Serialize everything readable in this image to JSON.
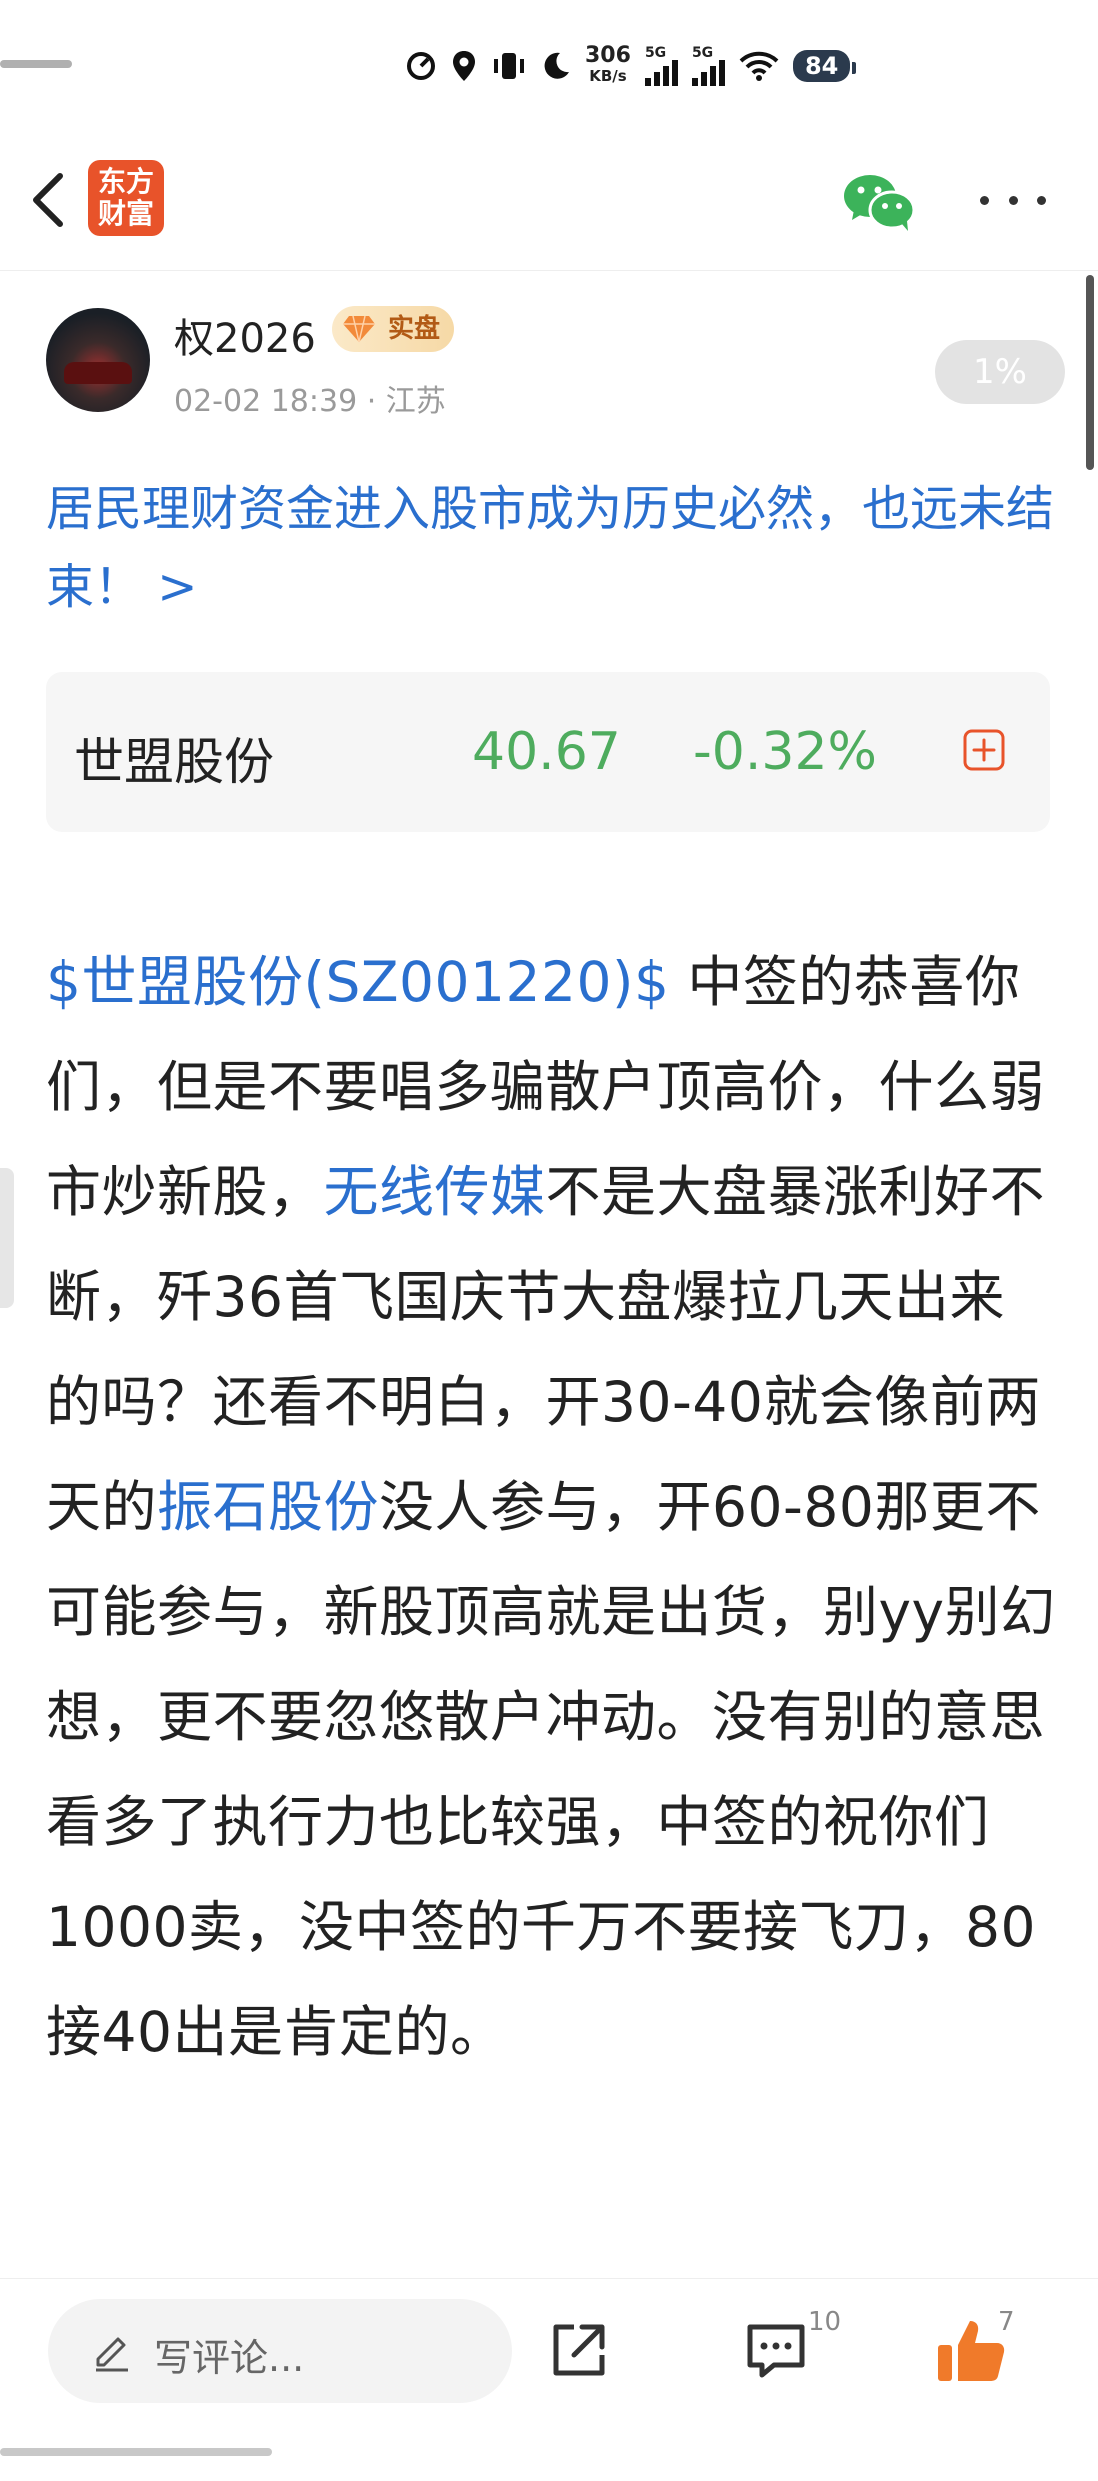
{
  "status_bar": {
    "net_speed": "306",
    "net_unit": "KB/s",
    "sim1": "5G",
    "sim2": "5G",
    "battery": "84"
  },
  "nav": {
    "logo_line1": "东方",
    "logo_line2": "财富",
    "icons": [
      "back-icon",
      "wechat-icon",
      "more-icon"
    ]
  },
  "author": {
    "name": "权2026",
    "badge": "实盘",
    "date": "02-02 18:39",
    "location": "· 江苏",
    "progress_label": "1%"
  },
  "post": {
    "headline": "居民理财资金进入股市成为历史必然，也远未结束！ >",
    "stock": {
      "name": "世盟股份",
      "price": "40.67",
      "change": "-0.32%"
    },
    "segments": [
      {
        "text": "$世盟股份(SZ001220)$",
        "link": true
      },
      {
        "text": "  中签的恭喜你们，但是不要唱多骗散户顶高价，什么弱市炒新股，",
        "link": false
      },
      {
        "text": "无线传媒",
        "link": true
      },
      {
        "text": "不是大盘暴涨利好不断，歼36首飞国庆节大盘爆拉几天出来的吗？还看不明白，开30-40就会像前两天的",
        "link": false
      },
      {
        "text": "振石股份",
        "link": true
      },
      {
        "text": "没人参与，开60-80那更不可能参与，新股顶高就是出货，别yy别幻想，更不要忽悠散户冲动。没有别的意思看多了执行力也比较强，中签的祝你们1000卖，没中签的千万不要接飞刀，80接40出是肯定的。",
        "link": false
      }
    ]
  },
  "bottom": {
    "comment_placeholder": "写评论...",
    "comment_count": "10",
    "like_count": "7"
  },
  "colors": {
    "link": "#2a6fce",
    "stock_green": "#4eac5e",
    "brand_orange": "#e8532a",
    "like_orange": "#f07a2a"
  }
}
